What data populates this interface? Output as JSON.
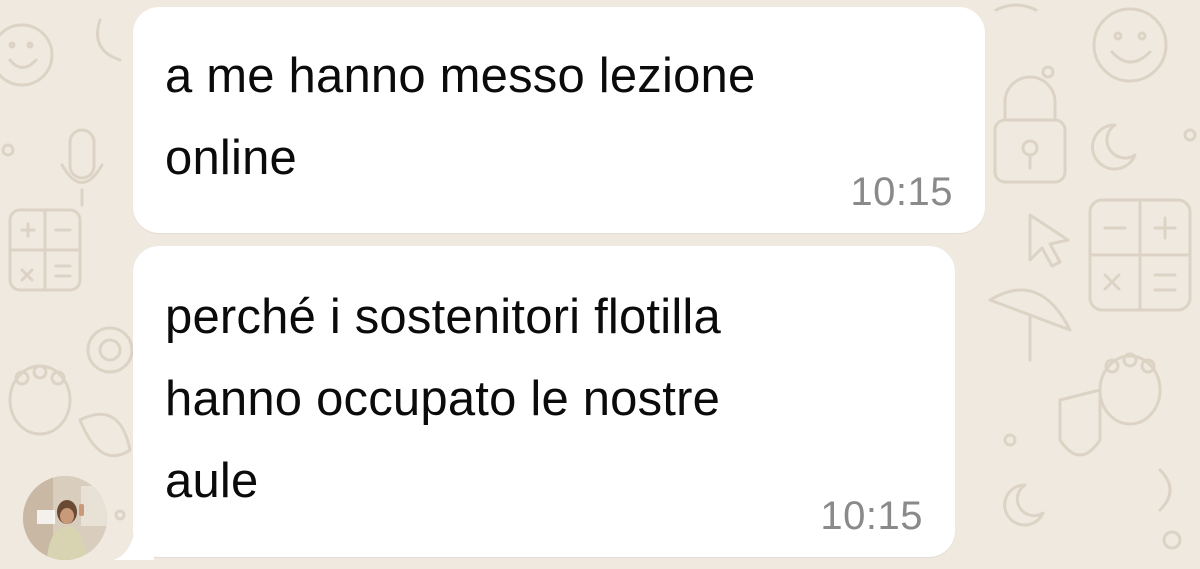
{
  "colors": {
    "chat_background": "#efe9e0",
    "bubble_background": "#ffffff",
    "message_text": "#0b0b0b",
    "timestamp_text": "#8a8a8a",
    "doodle_stroke": "#ddd3c4"
  },
  "messages": [
    {
      "text": "a me hanno messo lezione\nonline",
      "time": "10:15"
    },
    {
      "text": "perché i sostenitori flotilla\nhanno occupato le nostre\naule",
      "time": "10:15"
    }
  ],
  "sender": {
    "avatar_icon": "contact-avatar-photo"
  },
  "background_icons": [
    "smiley-icon",
    "microphone-icon",
    "calculator-icon",
    "padlock-icon",
    "cursor-arrow-icon",
    "moon-icon",
    "paw-icon",
    "umbrella-icon"
  ]
}
